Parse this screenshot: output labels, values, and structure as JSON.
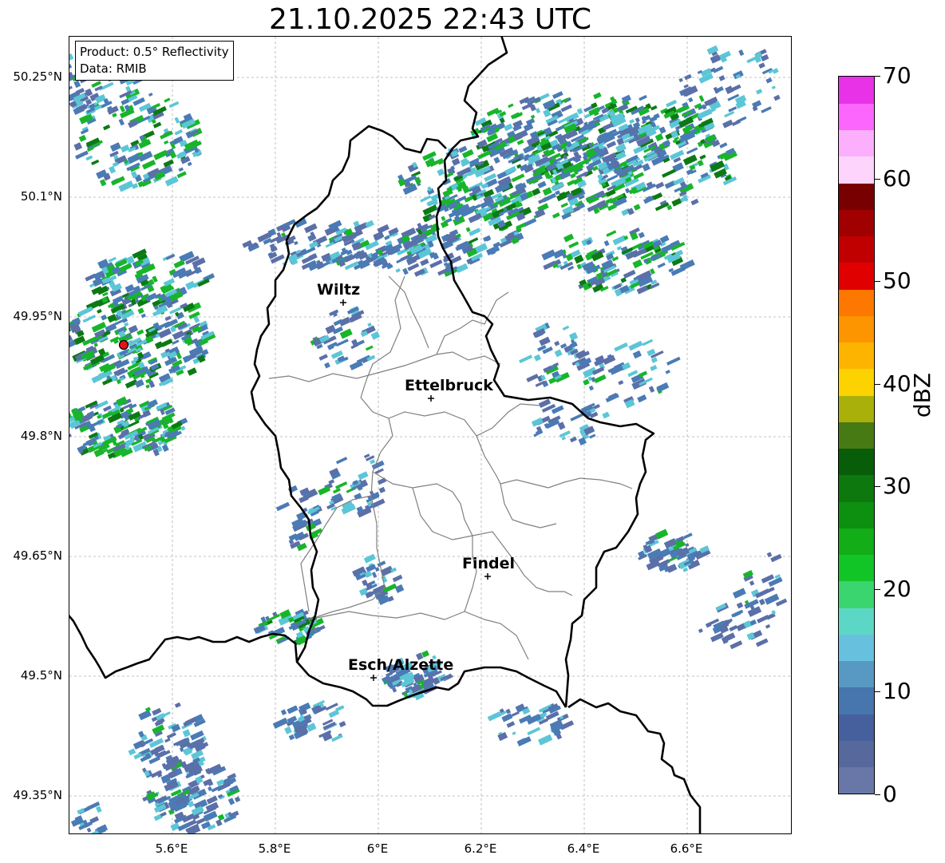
{
  "title": "21.10.2025 22:43 UTC",
  "info": {
    "product": "Product: 0.5° Reflectivity",
    "data": "Data: RMIB"
  },
  "map": {
    "lat_ticks": [
      "50.25°N",
      "50.1°N",
      "49.95°N",
      "49.8°N",
      "49.65°N",
      "49.5°N",
      "49.35°N"
    ],
    "lon_ticks": [
      "5.6°E",
      "5.8°E",
      "6°E",
      "6.2°E",
      "6.4°E",
      "6.6°E"
    ],
    "places": [
      "Wiltz",
      "Ettelbruck",
      "Findel",
      "Esch/Alzette"
    ],
    "radar_marker_color": "#e3131b",
    "country_border_color": "#000000",
    "canton_border_color": "#808080",
    "grid": true
  },
  "colorbar": {
    "label": "dBZ",
    "tick_labels": [
      "0",
      "10",
      "20",
      "30",
      "40",
      "50",
      "60",
      "70"
    ],
    "min": 0,
    "max": 70,
    "colors": [
      "#6876a8",
      "#56689c",
      "#45609c",
      "#4775ae",
      "#5899c4",
      "#67c0de",
      "#5cd7c6",
      "#3bd570",
      "#12c527",
      "#12ad17",
      "#0d8f10",
      "#0c780d",
      "#085d08",
      "#487a14",
      "#aab00a",
      "#fcd300",
      "#fcb400",
      "#fc9500",
      "#fc7800",
      "#e00000",
      "#c00000",
      "#a00000",
      "#780000",
      "#fcd4fc",
      "#fcaffc",
      "#fc66fc",
      "#e832e8"
    ]
  },
  "echo_colors": {
    "light": "#5b6fa8",
    "blue": "#4a7bb5",
    "cyan": "#5cc6d6",
    "green": "#18b52a",
    "dark_green": "#0c7a14",
    "yellow": "#e2c400"
  }
}
